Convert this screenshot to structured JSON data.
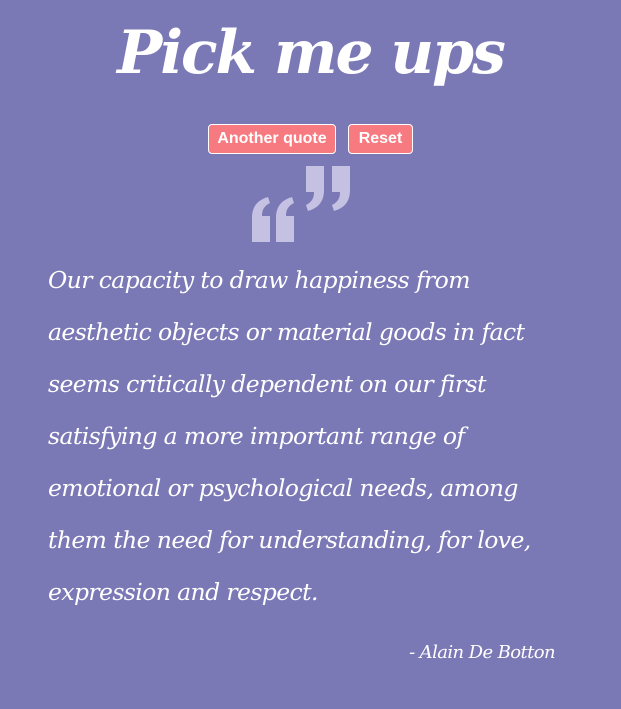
{
  "header": {
    "title": "Pick me ups"
  },
  "toolbar": {
    "another_label": "Another quote",
    "reset_label": "Reset"
  },
  "quote": {
    "text": "Our capacity to draw happiness from aesthetic objects or material goods in fact seems critically dependent on our first satisfying a more important range of emotional or psychological needs, among them the need for understanding, for love, expression and respect.",
    "author": "- Alain De Botton"
  },
  "colors": {
    "background": "#7b78b6",
    "button": "#f67a7f",
    "quote_mark": "#c4c1e3",
    "text": "#ffffff"
  },
  "icons": {
    "quote_mark": "quote-marks-icon"
  }
}
